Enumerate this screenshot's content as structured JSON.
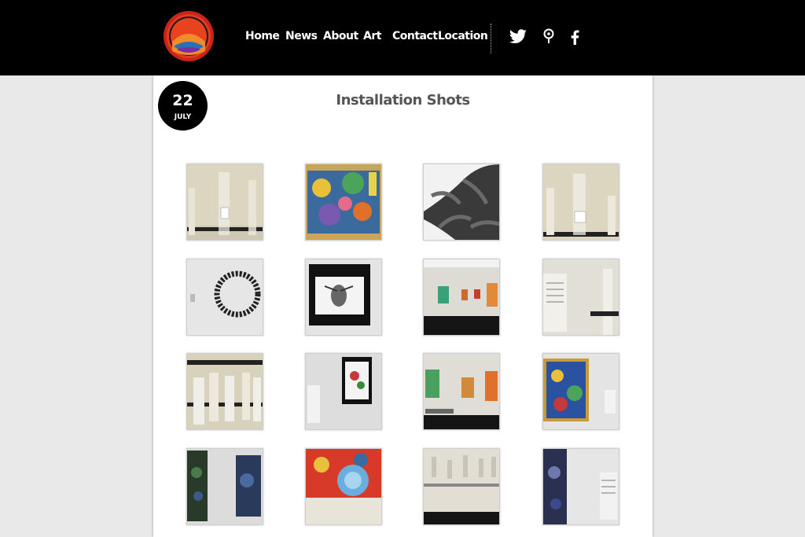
{
  "nav": {
    "items": [
      {
        "label": "Home"
      },
      {
        "label": "News"
      },
      {
        "label": "About"
      },
      {
        "label": "Art"
      },
      {
        "label": "Contact"
      },
      {
        "label": "Location"
      }
    ],
    "social": [
      "twitter-icon",
      "map-pin-icon",
      "facebook-icon"
    ]
  },
  "post": {
    "date_day": "22",
    "date_month": "JULY",
    "title": "Installation Shots"
  },
  "gallery": {
    "images": [
      {
        "subject": "glass bottles with tags on wall"
      },
      {
        "subject": "colorful abstract painting"
      },
      {
        "subject": "dark sculptural branches"
      },
      {
        "subject": "glass bottles with tags on wall"
      },
      {
        "subject": "circular wreath sculpture"
      },
      {
        "subject": "framed face drawing"
      },
      {
        "subject": "gallery room with paintings"
      },
      {
        "subject": "wall text and glass bottle"
      },
      {
        "subject": "row of hanging bottles"
      },
      {
        "subject": "framed flower painting"
      },
      {
        "subject": "gallery corner with paintings"
      },
      {
        "subject": "blue abstract painting"
      },
      {
        "subject": "two dark paintings"
      },
      {
        "subject": "painting with blue wax seal"
      },
      {
        "subject": "gallery with hanging installation"
      },
      {
        "subject": "dark painting and wall text"
      }
    ]
  },
  "colors": {
    "header_bg": "#000000",
    "page_bg": "#e9e9e9",
    "content_bg": "#ffffff",
    "title_color": "#555555"
  }
}
